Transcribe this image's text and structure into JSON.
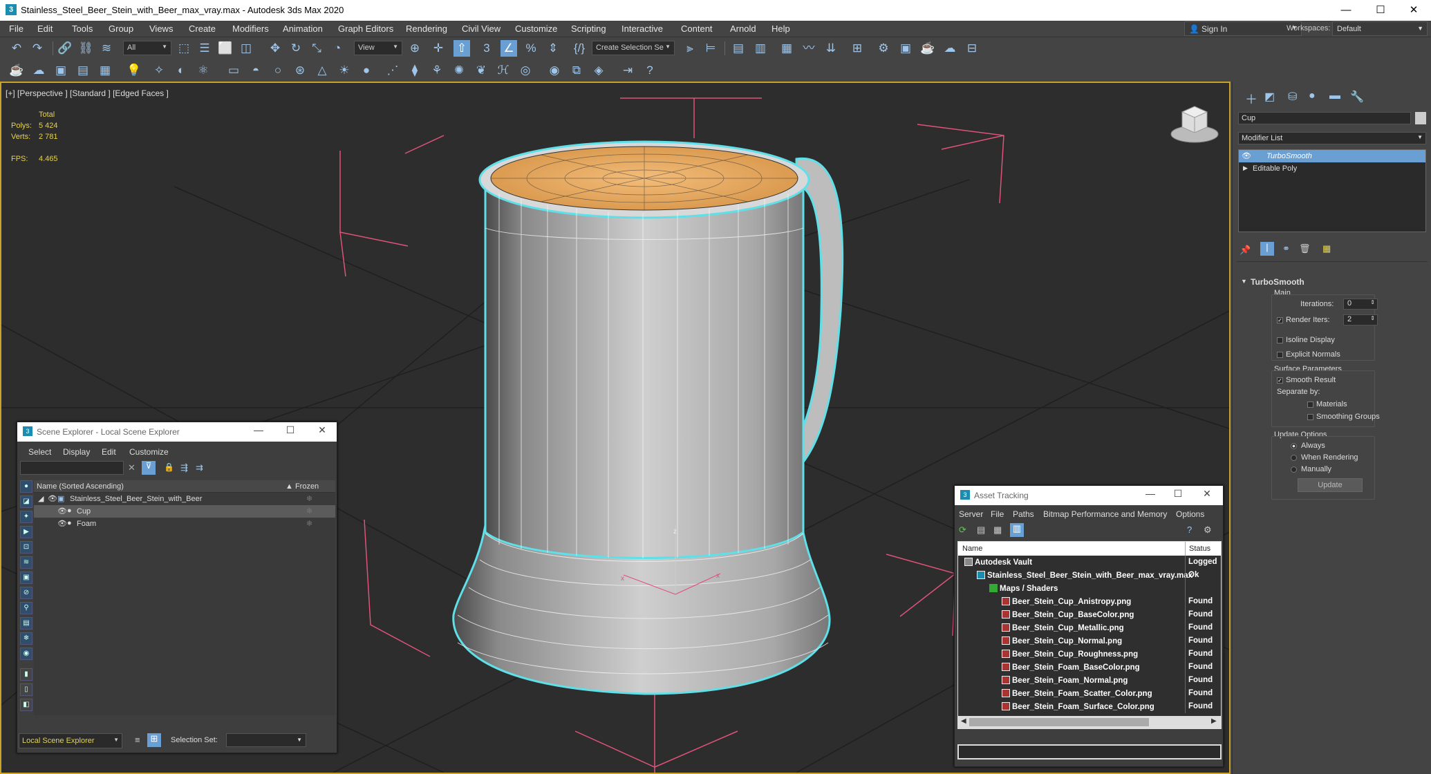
{
  "titlebar": {
    "title": "Stainless_Steel_Beer_Stein_with_Beer_max_vray.max - Autodesk 3ds Max 2020",
    "minimize": "—",
    "maximize": "☐",
    "close": "✕"
  },
  "menu": [
    "File",
    "Edit",
    "Tools",
    "Group",
    "Views",
    "Create",
    "Modifiers",
    "Animation",
    "Graph Editors",
    "Rendering",
    "Civil View",
    "Customize",
    "Scripting",
    "Interactive",
    "Content",
    "Arnold",
    "Help"
  ],
  "signin": {
    "label": "Sign In",
    "workspaces_label": "Workspaces:",
    "workspace_value": "Default"
  },
  "toolbar": {
    "filter_value": "All",
    "view_value": "View",
    "selection_set_placeholder": "Create Selection Se"
  },
  "viewport": {
    "label": "[+] [Perspective ] [Standard ] [Edged Faces ]",
    "stats": {
      "total_label": "Total",
      "polys_label": "Polys:",
      "polys_value": "5 424",
      "verts_label": "Verts:",
      "verts_value": "2 781",
      "fps_label": "FPS:",
      "fps_value": "4.465"
    },
    "axis_z": "z",
    "axis_x": "x",
    "axis_y": "x"
  },
  "command_panel": {
    "object_name": "Cup",
    "modifier_list": "Modifier List",
    "stack": [
      "TurboSmooth",
      "Editable Poly"
    ],
    "rollout_title": "TurboSmooth",
    "main_label": "Main",
    "iterations_label": "Iterations:",
    "iterations_value": "0",
    "render_iters_label": "Render Iters:",
    "render_iters_value": "2",
    "isoline_label": "Isoline Display",
    "explicit_normals_label": "Explicit Normals",
    "surface_params_label": "Surface Parameters",
    "smooth_result_label": "Smooth Result",
    "separate_by_label": "Separate by:",
    "materials_label": "Materials",
    "smoothing_groups_label": "Smoothing Groups",
    "update_options_label": "Update Options",
    "always_label": "Always",
    "when_rendering_label": "When Rendering",
    "manually_label": "Manually",
    "update_button": "Update"
  },
  "scene_explorer": {
    "title": "Scene Explorer - Local Scene Explorer",
    "menu": [
      "Select",
      "Display",
      "Edit",
      "Customize"
    ],
    "col_name": "Name (Sorted Ascending)",
    "col_frozen": "▲ Frozen",
    "root": "Stainless_Steel_Beer_Stein_with_Beer",
    "children": [
      "Cup",
      "Foam"
    ],
    "footer_dropdown": "Local Scene Explorer",
    "selection_set_label": "Selection Set:"
  },
  "asset_tracking": {
    "title": "Asset Tracking",
    "menu": [
      "Server",
      "File",
      "Paths",
      "Bitmap Performance and Memory",
      "Options"
    ],
    "col_name": "Name",
    "col_status": "Status",
    "rows": [
      {
        "name": "Autodesk Vault",
        "status": "Logged",
        "indent": 0
      },
      {
        "name": "Stainless_Steel_Beer_Stein_with_Beer_max_vray.max",
        "status": "Ok",
        "indent": 1
      },
      {
        "name": "Maps / Shaders",
        "status": "",
        "indent": 2
      },
      {
        "name": "Beer_Stein_Cup_Anistropy.png",
        "status": "Found",
        "indent": 3
      },
      {
        "name": "Beer_Stein_Cup_BaseColor.png",
        "status": "Found",
        "indent": 3
      },
      {
        "name": "Beer_Stein_Cup_Metallic.png",
        "status": "Found",
        "indent": 3
      },
      {
        "name": "Beer_Stein_Cup_Normal.png",
        "status": "Found",
        "indent": 3
      },
      {
        "name": "Beer_Stein_Cup_Roughness.png",
        "status": "Found",
        "indent": 3
      },
      {
        "name": "Beer_Stein_Foam_BaseColor.png",
        "status": "Found",
        "indent": 3
      },
      {
        "name": "Beer_Stein_Foam_Normal.png",
        "status": "Found",
        "indent": 3
      },
      {
        "name": "Beer_Stein_Foam_Scatter_Color.png",
        "status": "Found",
        "indent": 3
      },
      {
        "name": "Beer_Stein_Foam_Surface_Color.png",
        "status": "Found",
        "indent": 3
      }
    ]
  },
  "colors": {
    "accent_blue": "#9fc6ea",
    "viewport_border": "#c9a227",
    "selection_cyan": "#5fe0e8",
    "foam": "#e8aa63"
  }
}
